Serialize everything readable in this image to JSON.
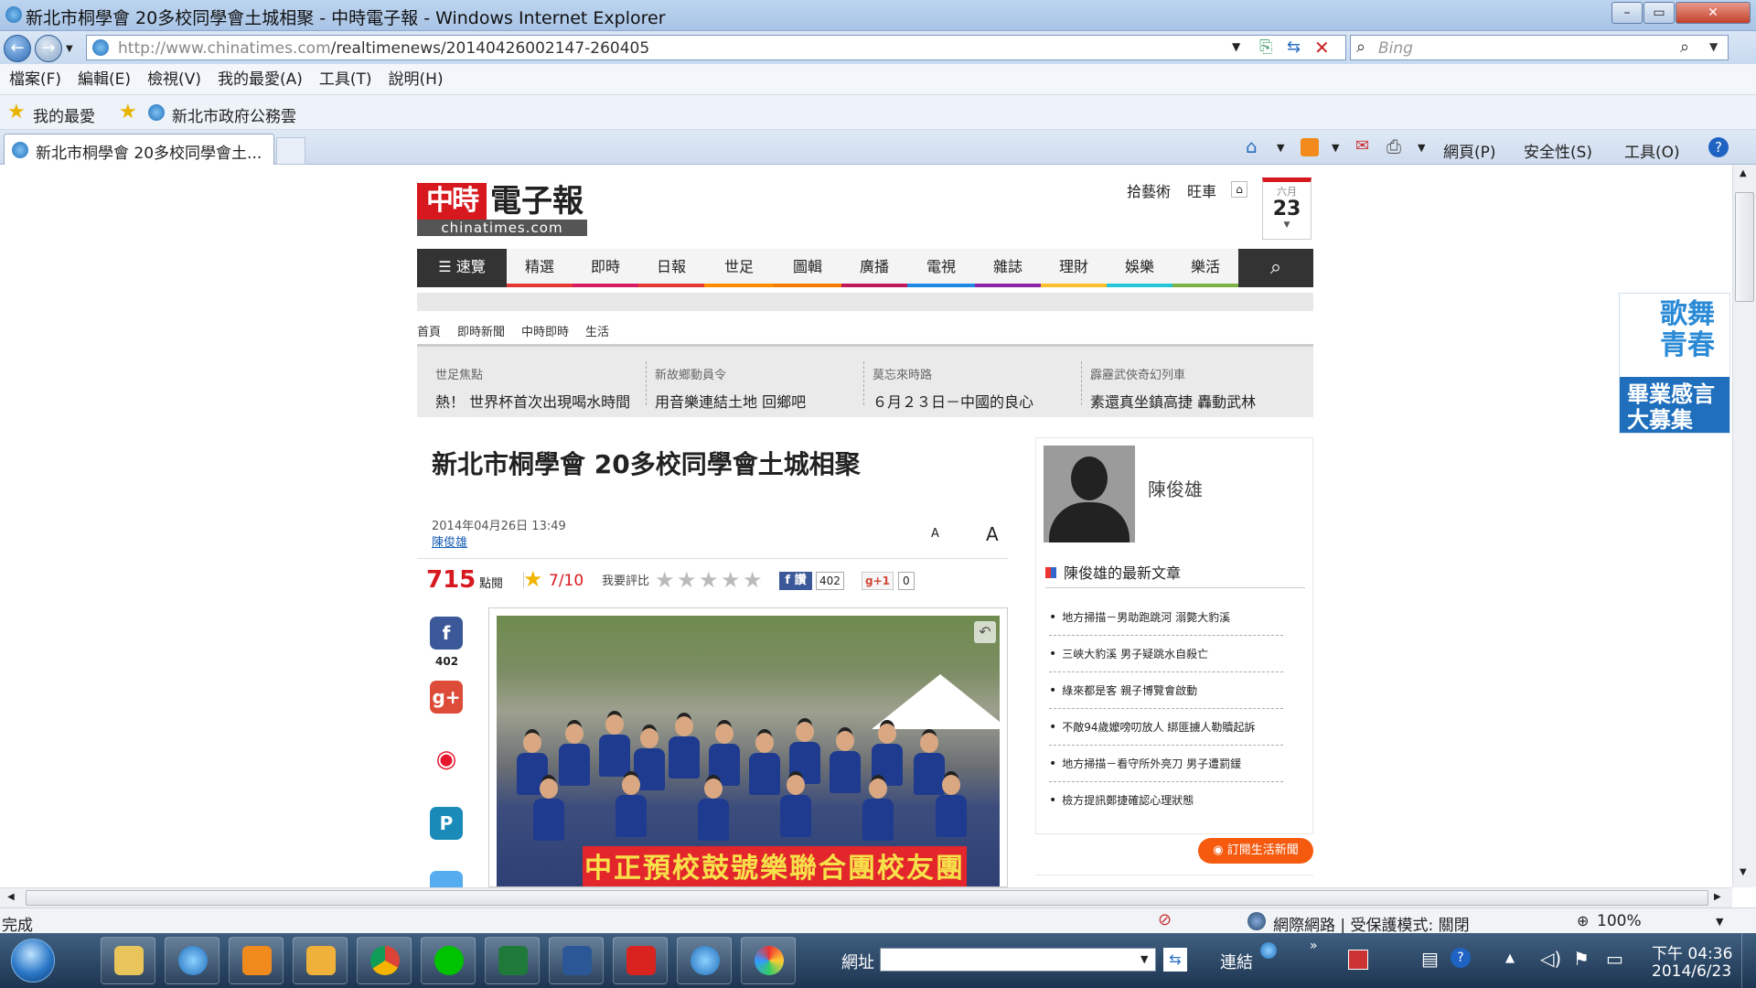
{
  "window": {
    "title": "新北市桐學會 20多校同學會土城相聚 - 中時電子報 - Windows Internet Explorer",
    "url_prefix": "http://www.chinatimes.com",
    "url_path": "/realtimenews/20140426002147-260405",
    "search_placeholder": "Bing"
  },
  "menu": [
    "檔案(F)",
    "編輯(E)",
    "檢視(V)",
    "我的最愛(A)",
    "工具(T)",
    "說明(H)"
  ],
  "favorites": {
    "label": "我的最愛",
    "item": "新北市政府公務雲"
  },
  "tab": {
    "label": "新北市桐學會 20多校同學會土..."
  },
  "commands": {
    "page": "網頁(P)",
    "safety": "安全性(S)",
    "tools": "工具(O)"
  },
  "site": {
    "logo_mark": "中時",
    "logo_text": "電子報",
    "logo_sub": "chinatimes.com",
    "top_links": [
      "拾藝術",
      "旺車"
    ],
    "calendar": {
      "month": "六月",
      "day": "23"
    },
    "nav": [
      "速覽",
      "精選",
      "即時",
      "日報",
      "世足",
      "圖輯",
      "廣播",
      "電視",
      "雜誌",
      "理財",
      "娛樂",
      "樂活"
    ],
    "nav_colors": [
      "#333333",
      "#e53935",
      "#d81b60",
      "#e53935",
      "#fb8c00",
      "#f57c00",
      "#c2185b",
      "#1e88e5",
      "#8e24aa",
      "#fbc02d",
      "#26c6da",
      "#7cb342"
    ],
    "breadcrumb": [
      "首頁",
      "即時新聞",
      "中時即時",
      "生活"
    ],
    "hot": [
      {
        "cat": "世足焦點",
        "title": "熱！ 世界杯首次出現喝水時間"
      },
      {
        "cat": "新故鄉動員令",
        "title": "用音樂連結土地 回鄉吧"
      },
      {
        "cat": "莫忘來時路",
        "title": "６月２３日－中國的良心"
      },
      {
        "cat": "霹靂武俠奇幻列車",
        "title": "素還真坐鎮高捷 轟動武林"
      }
    ]
  },
  "article": {
    "title": "新北市桐學會 20多校同學會土城相聚",
    "date": "2014年04月26日 13:49",
    "author": "陳俊雄",
    "font_small": "A",
    "font_large": "A",
    "views": "715",
    "views_label": "點閱",
    "score": "7/10",
    "rate_label": "我要評比",
    "fb_label": "f 讚",
    "fb_count": "402",
    "gplus_label": "g+1",
    "gplus_count": "0",
    "share_fb_count": "402",
    "photo_banner": "中正預校鼓號樂聯合團校友團"
  },
  "sidebar": {
    "author_name": "陳俊雄",
    "latest_heading": "陳俊雄的最新文章",
    "latest": [
      "地方掃描－男助跑跳河 溺斃大豹溪",
      "三峽大豹溪 男子疑跳水自殺亡",
      "綠來都是客 親子博覽會啟動",
      "不敵94歲嬤嗙叨放人 綁匪擄人勒贖起訴",
      "地方掃描－看守所外亮刀 男子遭罰鍰",
      "檢方提訊鄭捷確認心理狀態"
    ],
    "subscribe": "訂閱生活新聞"
  },
  "ad": {
    "line1": "歌舞青春",
    "line2": "畢業感言大募集"
  },
  "status": {
    "left": "完成",
    "zone": "網際網路 | 受保護模式: 關閉",
    "zoom": "100%"
  },
  "taskbar": {
    "address_label": "網址",
    "links_label": "連結",
    "time": "下午 04:36",
    "date": "2014/6/23"
  }
}
